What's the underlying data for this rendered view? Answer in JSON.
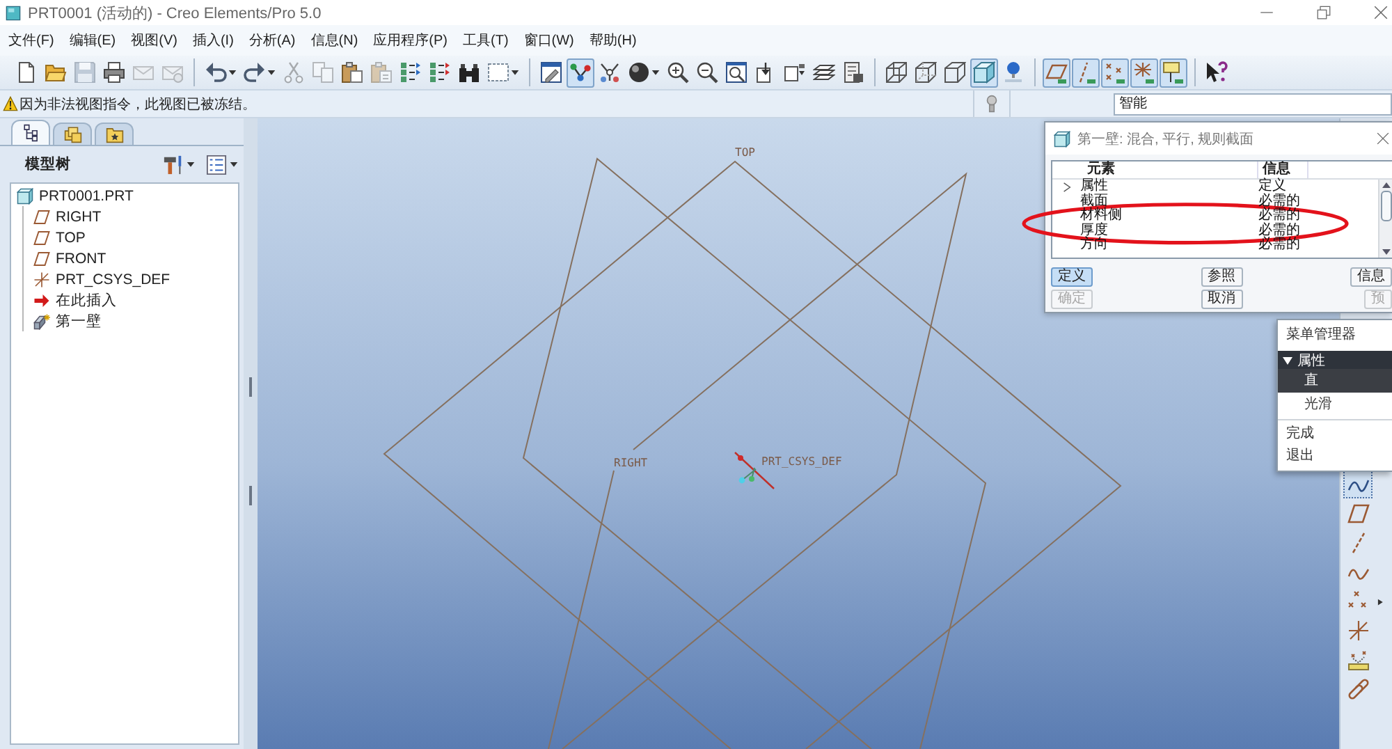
{
  "window": {
    "title": "PRT0001 (活动的) - Creo Elements/Pro 5.0"
  },
  "menu_bar": [
    {
      "label": "文件(F)"
    },
    {
      "label": "编辑(E)"
    },
    {
      "label": "视图(V)"
    },
    {
      "label": "插入(I)"
    },
    {
      "label": "分析(A)"
    },
    {
      "label": "信息(N)"
    },
    {
      "label": "应用程序(P)"
    },
    {
      "label": "工具(T)"
    },
    {
      "label": "窗口(W)"
    },
    {
      "label": "帮助(H)"
    }
  ],
  "toolbar": [
    [
      {
        "kind": "new",
        "pressed": false,
        "disabled": false,
        "dropdown": false
      },
      {
        "kind": "open",
        "pressed": false,
        "disabled": false,
        "dropdown": false
      },
      {
        "kind": "save",
        "pressed": false,
        "disabled": true,
        "dropdown": false
      },
      {
        "kind": "print",
        "pressed": false,
        "disabled": false,
        "dropdown": false
      },
      {
        "kind": "mail",
        "pressed": false,
        "disabled": true,
        "dropdown": false
      },
      {
        "kind": "mail_attach",
        "pressed": false,
        "disabled": true,
        "dropdown": false
      }
    ],
    [
      {
        "kind": "undo",
        "pressed": false,
        "disabled": false,
        "dropdown": true
      },
      {
        "kind": "redo",
        "pressed": false,
        "disabled": false,
        "dropdown": true
      },
      {
        "kind": "cut",
        "pressed": false,
        "disabled": true,
        "dropdown": false
      },
      {
        "kind": "copy",
        "pressed": false,
        "disabled": true,
        "dropdown": false
      },
      {
        "kind": "paste",
        "pressed": false,
        "disabled": false,
        "dropdown": false
      },
      {
        "kind": "paste_special",
        "pressed": false,
        "disabled": true,
        "dropdown": false
      },
      {
        "kind": "regenerate",
        "pressed": false,
        "disabled": false,
        "dropdown": false
      },
      {
        "kind": "regen_manager",
        "pressed": false,
        "disabled": false,
        "dropdown": false
      },
      {
        "kind": "find",
        "pressed": false,
        "disabled": false,
        "dropdown": false
      },
      {
        "kind": "select",
        "pressed": false,
        "disabled": false,
        "dropdown": true
      }
    ],
    [
      {
        "kind": "repaint",
        "pressed": false,
        "disabled": false,
        "dropdown": false
      },
      {
        "kind": "spin_center",
        "pressed": true,
        "disabled": false,
        "dropdown": false
      },
      {
        "kind": "orient",
        "pressed": false,
        "disabled": false,
        "dropdown": false
      },
      {
        "kind": "shading",
        "pressed": false,
        "disabled": false,
        "dropdown": true
      },
      {
        "kind": "zoom_in",
        "pressed": false,
        "disabled": false,
        "dropdown": false
      },
      {
        "kind": "zoom_out",
        "pressed": false,
        "disabled": false,
        "dropdown": false
      },
      {
        "kind": "refit",
        "pressed": false,
        "disabled": false,
        "dropdown": false
      },
      {
        "kind": "reorient",
        "pressed": false,
        "disabled": false,
        "dropdown": false
      },
      {
        "kind": "saved_views",
        "pressed": false,
        "disabled": false,
        "dropdown": false
      },
      {
        "kind": "layers",
        "pressed": false,
        "disabled": false,
        "dropdown": false
      },
      {
        "kind": "appearance",
        "pressed": false,
        "disabled": false,
        "dropdown": false
      }
    ],
    [
      {
        "kind": "wireframe",
        "pressed": false,
        "disabled": false,
        "dropdown": false
      },
      {
        "kind": "hidden_line",
        "pressed": false,
        "disabled": false,
        "dropdown": false
      },
      {
        "kind": "no_hidden",
        "pressed": false,
        "disabled": false,
        "dropdown": false
      },
      {
        "kind": "shaded",
        "pressed": true,
        "disabled": false,
        "dropdown": false
      },
      {
        "kind": "model_display",
        "pressed": false,
        "disabled": false,
        "dropdown": false
      }
    ],
    [
      {
        "kind": "plane_display",
        "pressed": true,
        "disabled": false,
        "dropdown": false
      },
      {
        "kind": "axis_display",
        "pressed": true,
        "disabled": false,
        "dropdown": false
      },
      {
        "kind": "point_display",
        "pressed": true,
        "disabled": false,
        "dropdown": false
      },
      {
        "kind": "csys_display",
        "pressed": true,
        "disabled": false,
        "dropdown": false
      },
      {
        "kind": "annotation_display",
        "pressed": true,
        "disabled": false,
        "dropdown": false
      }
    ],
    [
      {
        "kind": "help",
        "pressed": false,
        "disabled": false,
        "dropdown": false
      }
    ]
  ],
  "message": {
    "kind": "warning",
    "text": "因为非法视图指令，此视图已被冻结。"
  },
  "filter": {
    "value": "智能"
  },
  "model_tree": {
    "tabs": [
      {
        "kind": "tree",
        "selected": true
      },
      {
        "kind": "layers",
        "selected": false
      },
      {
        "kind": "favorites",
        "selected": false
      }
    ],
    "title": "模型树",
    "items": [
      {
        "kind": "part",
        "label": "PRT0001.PRT",
        "children": [
          {
            "kind": "plane",
            "label": "RIGHT"
          },
          {
            "kind": "plane",
            "label": "TOP"
          },
          {
            "kind": "plane",
            "label": "FRONT"
          },
          {
            "kind": "csys",
            "label": "PRT_CSYS_DEF"
          },
          {
            "kind": "insert",
            "label": "在此插入"
          },
          {
            "kind": "feature",
            "label": "第一壁"
          }
        ]
      }
    ]
  },
  "graphics": {
    "planes": [
      {
        "kind": "labeled",
        "label": "TOP"
      },
      {
        "kind": "unlabeled"
      },
      {
        "kind": "labeled",
        "label": "RIGHT"
      }
    ],
    "csys": {
      "label": "PRT_CSYS_DEF"
    }
  },
  "side_toolbar": [
    {
      "kind": "sketch",
      "pressed": true,
      "flyout": false
    },
    {
      "kind": "plane",
      "pressed": false,
      "flyout": false
    },
    {
      "kind": "axis",
      "pressed": false,
      "flyout": false
    },
    {
      "kind": "curve",
      "pressed": false,
      "flyout": false
    },
    {
      "kind": "point",
      "pressed": false,
      "flyout": true
    },
    {
      "kind": "csys",
      "pressed": false,
      "flyout": false
    },
    {
      "kind": "analysis",
      "pressed": false,
      "flyout": false
    },
    {
      "kind": "link",
      "pressed": false,
      "flyout": false
    }
  ],
  "dialog": {
    "title": "第一壁: 混合, 平行, 规则截面",
    "columns": [
      "元素",
      "信息"
    ],
    "rows": [
      {
        "element": "属性",
        "info": "定义",
        "current": true,
        "circled": false
      },
      {
        "element": "截面",
        "info": "必需的",
        "current": false,
        "circled": false
      },
      {
        "element": "材料侧",
        "info": "必需的",
        "current": false,
        "circled": true
      },
      {
        "element": "厚度",
        "info": "必需的",
        "current": false,
        "circled": true
      },
      {
        "element": "方向",
        "info": "必需的",
        "current": false,
        "circled": false
      }
    ],
    "button_rows": [
      [
        {
          "label": "定义",
          "selected": true,
          "disabled": false
        },
        {
          "label": "参照",
          "selected": false,
          "disabled": false
        },
        {
          "label": "信息",
          "selected": false,
          "disabled": false
        }
      ],
      [
        {
          "label": "确定",
          "selected": false,
          "disabled": true
        },
        {
          "label": "取消",
          "selected": false,
          "disabled": false
        },
        {
          "label": "预",
          "selected": false,
          "disabled": true
        }
      ]
    ]
  },
  "menu_manager": {
    "title": "菜单管理器",
    "section": {
      "label": "属性",
      "expanded": true,
      "items": [
        {
          "label": "直",
          "selected": true
        },
        {
          "label": "光滑",
          "selected": false
        }
      ]
    },
    "actions": [
      {
        "label": "完成"
      },
      {
        "label": "退出"
      }
    ]
  }
}
